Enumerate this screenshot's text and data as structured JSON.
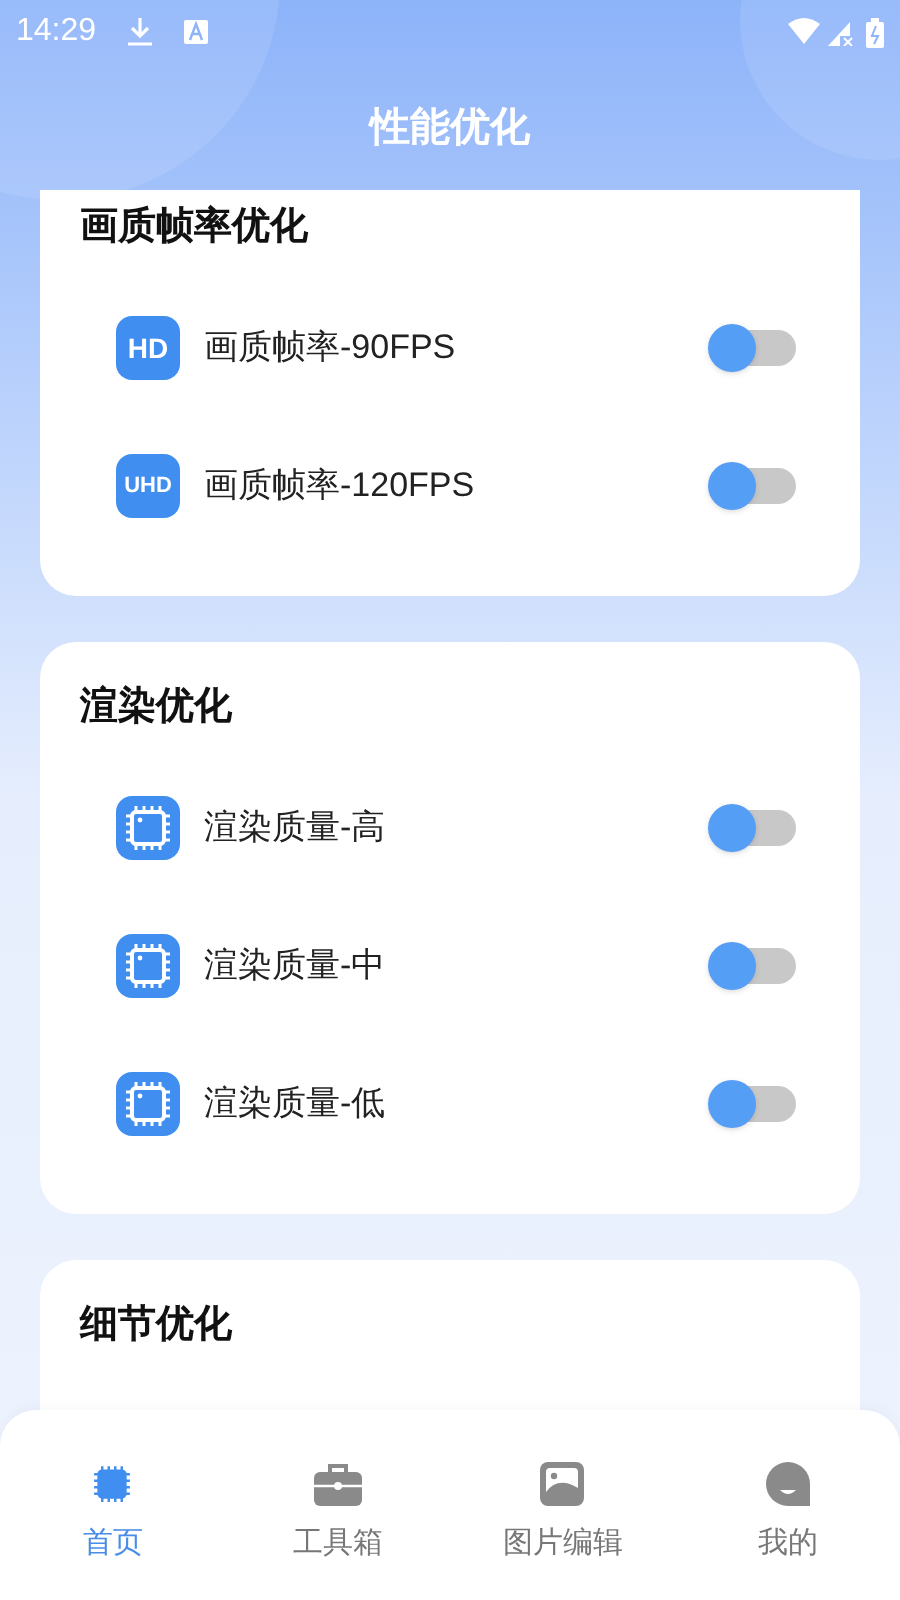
{
  "status_bar": {
    "time": "14:29"
  },
  "title": "性能优化",
  "sections": [
    {
      "title": "画质帧率优化",
      "items": [
        {
          "kind": "hd",
          "icon_text": "HD",
          "label": "画质帧率-90FPS",
          "on": false
        },
        {
          "kind": "hd",
          "icon_text": "UHD",
          "label": "画质帧率-120FPS",
          "on": false
        }
      ]
    },
    {
      "title": "渲染优化",
      "items": [
        {
          "kind": "chip",
          "label": "渲染质量-高",
          "on": false
        },
        {
          "kind": "chip",
          "label": "渲染质量-中",
          "on": false
        },
        {
          "kind": "chip",
          "label": "渲染质量-低",
          "on": false
        }
      ]
    },
    {
      "title": "细节优化"
    }
  ],
  "nav": [
    {
      "kind": "chip",
      "label": "首页",
      "selected": true
    },
    {
      "kind": "toolbox",
      "label": "工具箱",
      "selected": false
    },
    {
      "kind": "image",
      "label": "图片编辑",
      "selected": false
    },
    {
      "kind": "face",
      "label": "我的",
      "selected": false
    }
  ]
}
